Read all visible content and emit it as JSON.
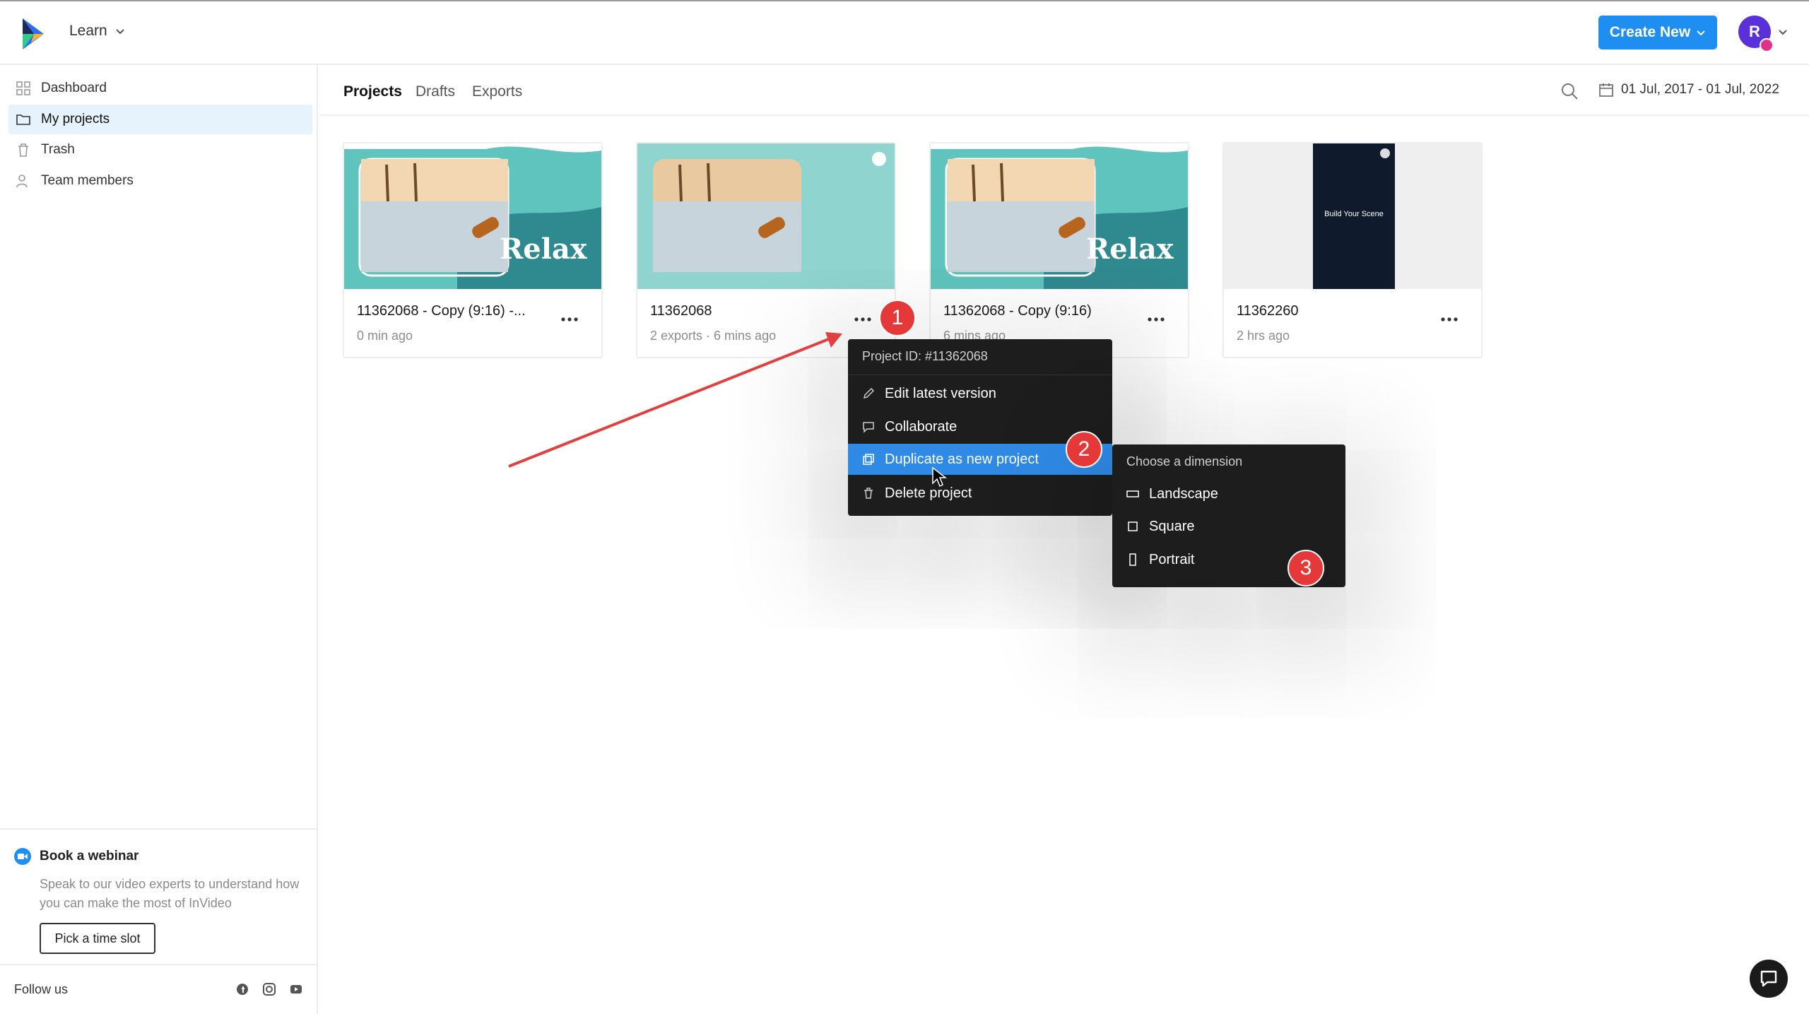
{
  "header": {
    "learn_label": "Learn",
    "create_new_label": "Create New",
    "avatar_initial": "R"
  },
  "sidebar": {
    "items": [
      {
        "label": "Dashboard",
        "icon": "grid-icon"
      },
      {
        "label": "My projects",
        "icon": "folder-icon",
        "active": true
      },
      {
        "label": "Trash",
        "icon": "trash-icon"
      },
      {
        "label": "Team members",
        "icon": "users-icon"
      }
    ],
    "webinar": {
      "title": "Book a webinar",
      "text": "Speak to our video experts to understand how you can make the most of InVideo",
      "button": "Pick a time slot"
    },
    "follow_label": "Follow us"
  },
  "tabs": [
    {
      "label": "Projects",
      "active": true
    },
    {
      "label": "Drafts"
    },
    {
      "label": "Exports"
    }
  ],
  "date_range": "01 Jul, 2017 - 01 Jul, 2022",
  "projects": [
    {
      "title": "11362068 - Copy (9:16) -...",
      "meta": "0 min ago",
      "thumb_text": "Relax"
    },
    {
      "title": "11362068",
      "meta": "2 exports · 6 mins ago",
      "thumb_text": ""
    },
    {
      "title": "11362068 - Copy (9:16)",
      "meta": "6 mins ago",
      "thumb_text": "Relax"
    },
    {
      "title": "11362260",
      "meta": "2 hrs ago",
      "thumb_text": "Build Your Scene"
    }
  ],
  "context_menu": {
    "header": "Project ID: #11362068",
    "items": [
      {
        "label": "Edit latest version",
        "icon": "pencil-icon"
      },
      {
        "label": "Collaborate",
        "icon": "comment-icon"
      },
      {
        "label": "Duplicate as new project",
        "icon": "copy-icon",
        "highlighted": true
      },
      {
        "label": "Delete project",
        "icon": "trash-icon"
      }
    ]
  },
  "submenu": {
    "header": "Choose a dimension",
    "items": [
      {
        "label": "Landscape",
        "icon": "landscape-icon"
      },
      {
        "label": "Square",
        "icon": "square-icon"
      },
      {
        "label": "Portrait",
        "icon": "portrait-icon"
      }
    ]
  },
  "annotations": [
    "1",
    "2",
    "3"
  ],
  "colors": {
    "accent": "#1f8ef1",
    "menu_bg": "#1d1d1d",
    "highlight": "#2f8ae6",
    "badge": "#e53939",
    "thumb_teal": "#5fc4bd"
  }
}
